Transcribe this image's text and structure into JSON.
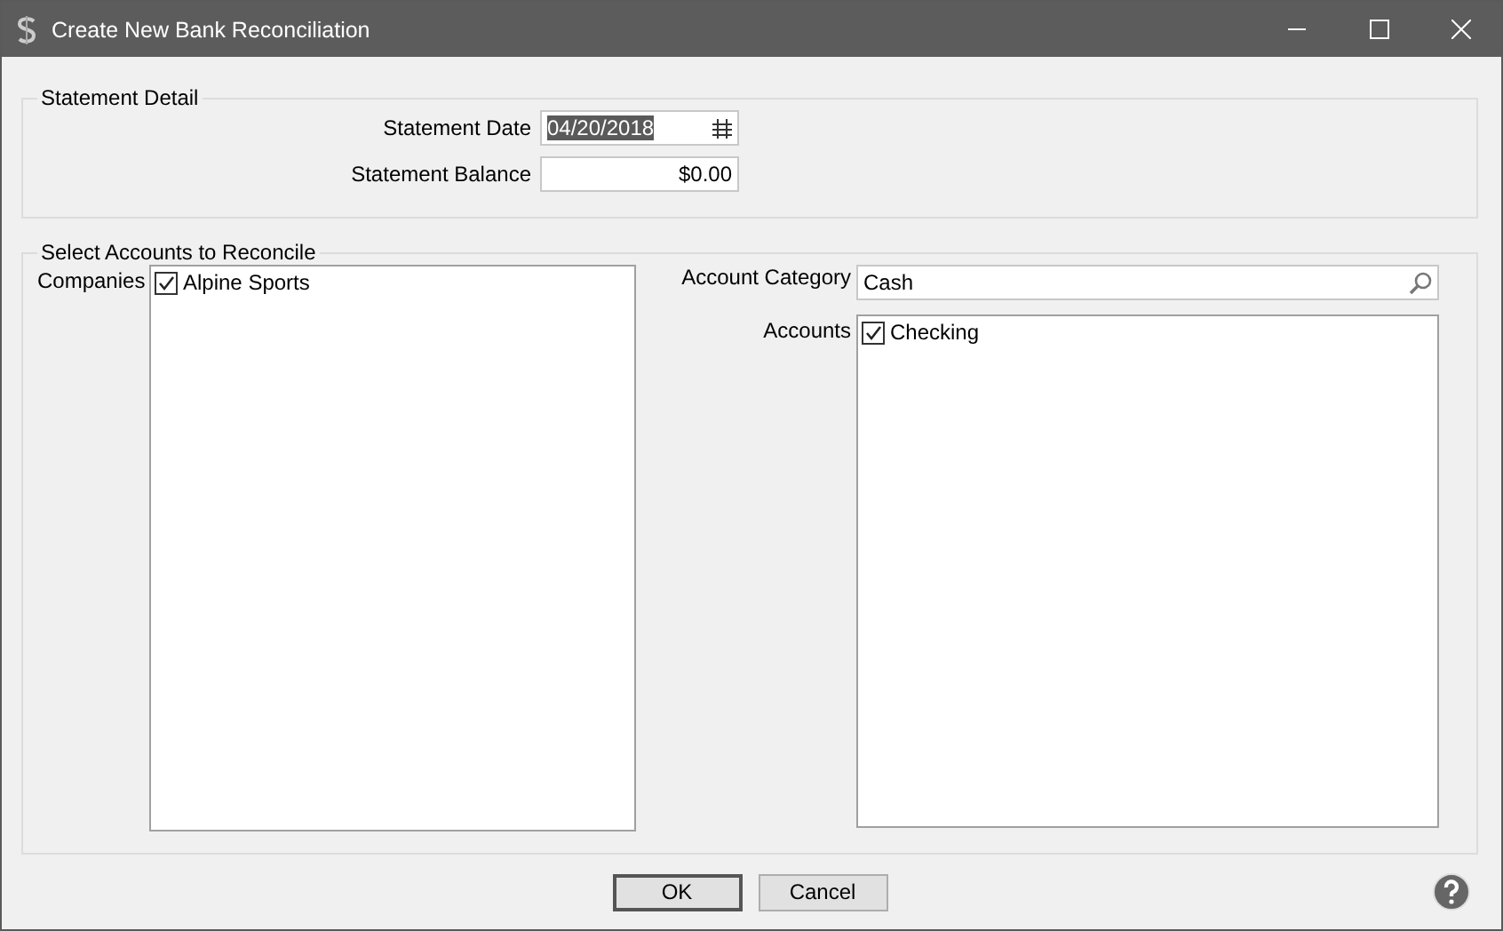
{
  "window": {
    "title": "Create New Bank Reconciliation"
  },
  "statement_detail": {
    "legend": "Statement Detail",
    "date_label": "Statement Date",
    "date_value": "04/20/2018",
    "balance_label": "Statement Balance",
    "balance_value": "$0.00"
  },
  "select_accounts": {
    "legend": "Select Accounts to Reconcile",
    "companies_label": "Companies",
    "companies": [
      {
        "label": "Alpine Sports",
        "checked": true
      }
    ],
    "category_label": "Account Category",
    "category_value": "Cash",
    "accounts_label": "Accounts",
    "accounts": [
      {
        "label": "Checking",
        "checked": true
      }
    ]
  },
  "buttons": [
    {
      "label": "OK",
      "default": true
    },
    {
      "label": "Cancel",
      "default": false
    }
  ]
}
